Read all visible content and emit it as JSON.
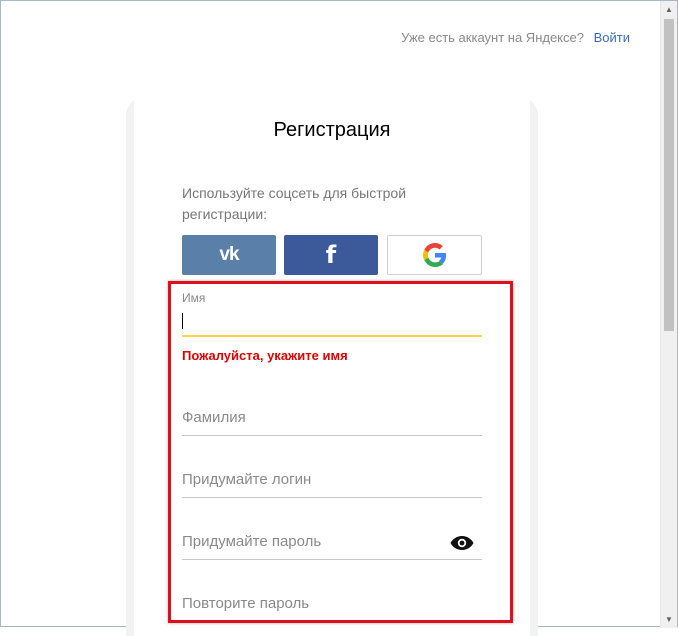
{
  "header": {
    "have_account_text": "Уже есть аккаунт на Яндексе?",
    "login_link": "Войти"
  },
  "form": {
    "title": "Регистрация",
    "social_caption": "Используйте соцсеть для быстрой регистрации:",
    "social": {
      "vk_label": "vk",
      "facebook_label": "f",
      "google_icon": "google-g-icon"
    },
    "fields": {
      "first_name": {
        "label": "Имя",
        "value": "",
        "error": "Пожалуйста, укажите имя"
      },
      "last_name": {
        "placeholder": "Фамилия"
      },
      "login": {
        "placeholder": "Придумайте логин"
      },
      "password": {
        "placeholder": "Придумайте пароль",
        "icon": "eye-icon"
      },
      "password_repeat": {
        "placeholder": "Повторите пароль"
      }
    }
  },
  "colors": {
    "accent_yellow": "#ffd24a",
    "error_red": "#e00000",
    "highlight_red": "#e10e1e",
    "vk_blue": "#5a7fa8",
    "facebook_blue": "#3c5a99",
    "link_blue": "#3b6db3"
  }
}
